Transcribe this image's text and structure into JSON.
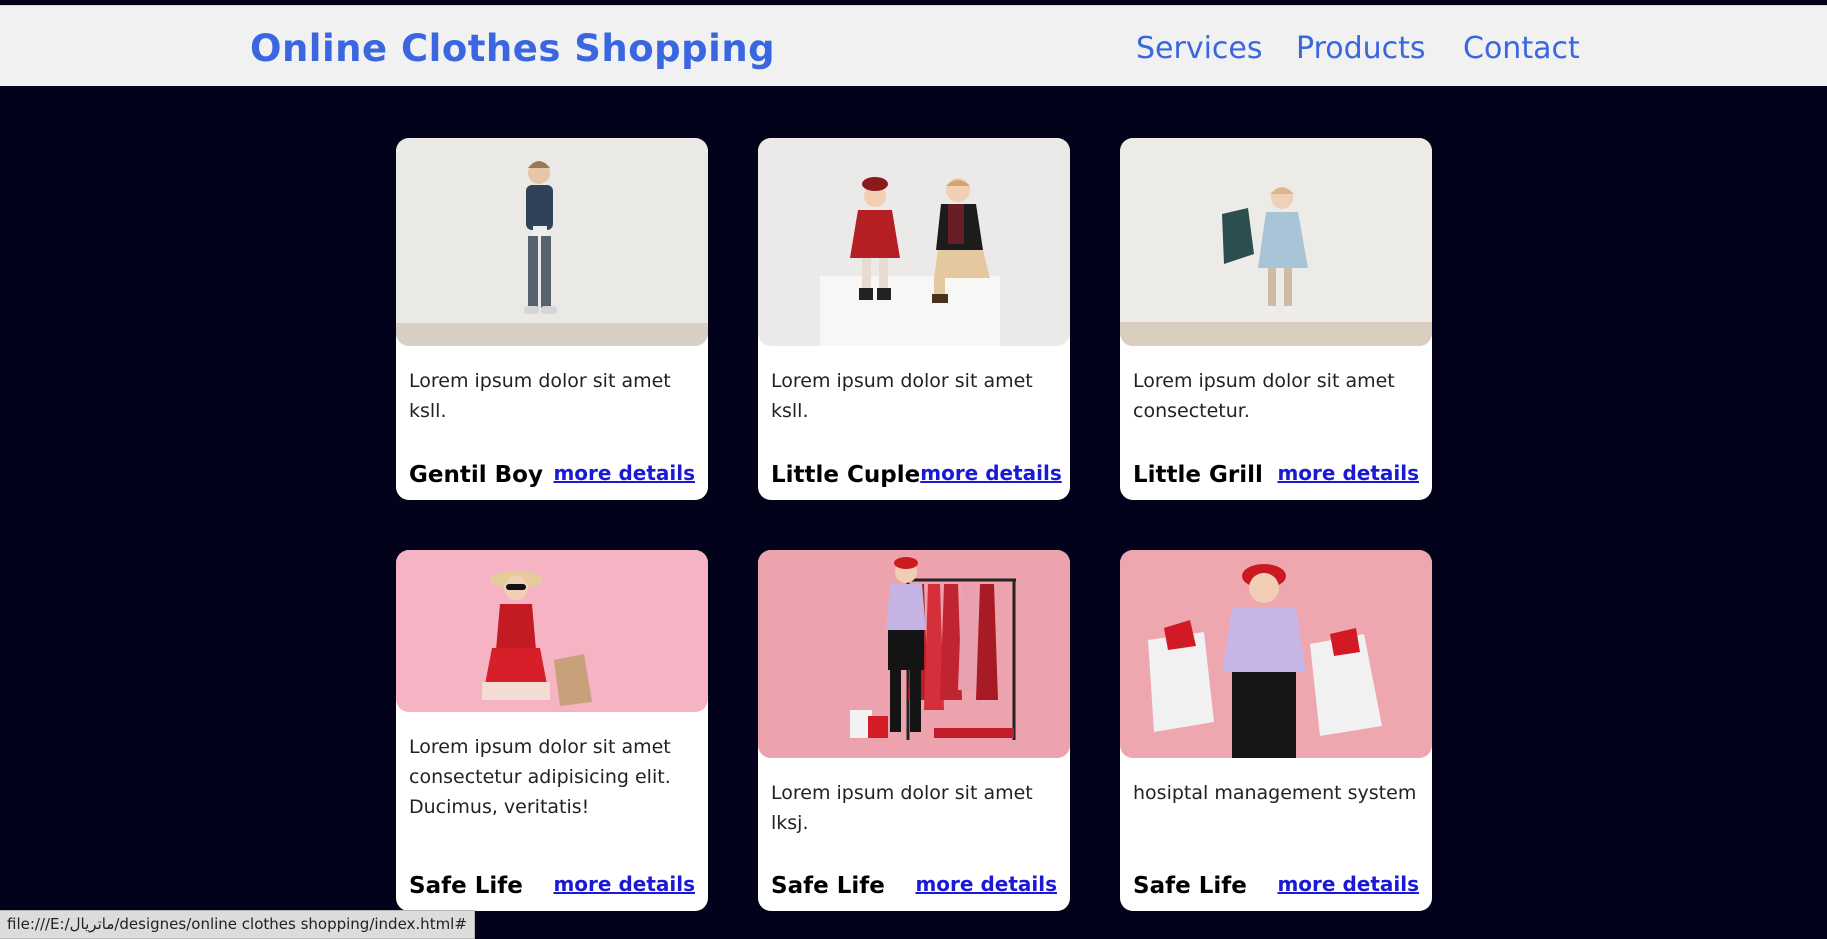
{
  "header": {
    "logo": "Online Clothes Shopping",
    "nav": [
      "Services",
      "Products",
      "Contact"
    ]
  },
  "cards": [
    {
      "desc": "Lorem ipsum dolor sit amet ksll.",
      "title": "Gentil Boy",
      "link": "more details"
    },
    {
      "desc": "Lorem ipsum dolor sit amet ksll.",
      "title": "Little Cuple",
      "link": "more details"
    },
    {
      "desc": "Lorem ipsum dolor sit amet consectetur.",
      "title": "Little Grill",
      "link": "more details"
    },
    {
      "desc": "Lorem ipsum dolor sit amet consectetur adipisicing elit. Ducimus, veritatis!",
      "title": "Safe Life",
      "link": "more details"
    },
    {
      "desc": "Lorem ipsum dolor sit amet lksj.",
      "title": "Safe Life",
      "link": "more details"
    },
    {
      "desc": "hosiptal management system",
      "title": "Safe Life",
      "link": "more details"
    }
  ],
  "status_bar": {
    "url": "file:///E:/ماتریال/designes/online clothes shopping/index.html#"
  },
  "colors": {
    "accent": "#3a67e0",
    "background": "#02021a",
    "link": "#1a1ad6"
  }
}
